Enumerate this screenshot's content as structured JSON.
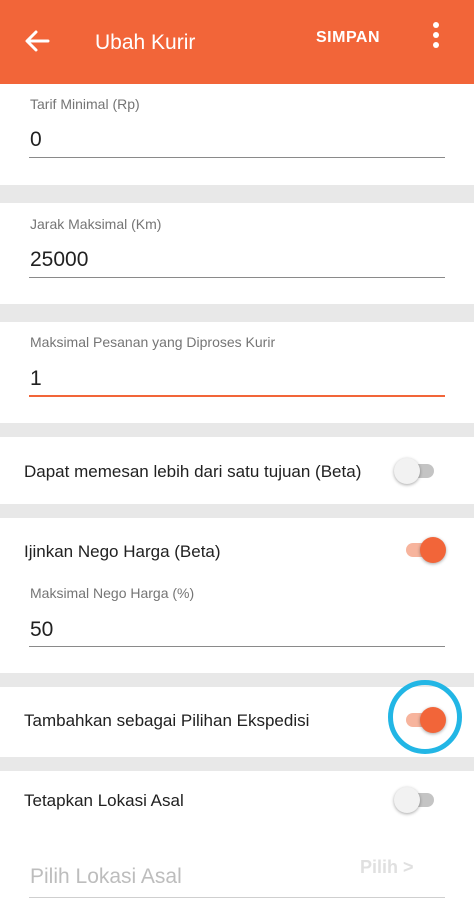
{
  "appbar": {
    "title": "Ubah Kurir",
    "save_label": "SIMPAN",
    "back_icon": "arrow-left-icon",
    "menu_icon": "more-vertical-icon",
    "color": "#f26539"
  },
  "form": {
    "min_fare": {
      "label": "Tarif Minimal (Rp)",
      "value": "0"
    },
    "max_distance": {
      "label": "Jarak Maksimal (Km)",
      "value": "25000"
    },
    "max_orders": {
      "label": "Maksimal Pesanan yang Diproses Kurir",
      "value": "1"
    },
    "multi_destination": {
      "label": "Dapat memesan lebih dari satu tujuan (Beta)",
      "enabled": false
    },
    "price_nego": {
      "label": "Ijinkan Nego Harga (Beta)",
      "enabled": true
    },
    "max_nego": {
      "label": "Maksimal Nego Harga (%)",
      "value": "50"
    },
    "add_expedition": {
      "label": "Tambahkan sebagai Pilihan Ekspedisi",
      "enabled": true
    },
    "set_origin": {
      "label": "Tetapkan Lokasi Asal",
      "enabled": false
    },
    "origin_location": {
      "placeholder": "Pilih Lokasi Asal",
      "pick_label": "Pilih >"
    }
  },
  "colors": {
    "accent": "#f26539",
    "highlight_ring": "#22b6e5",
    "divider_bg": "#e8e8e8"
  }
}
